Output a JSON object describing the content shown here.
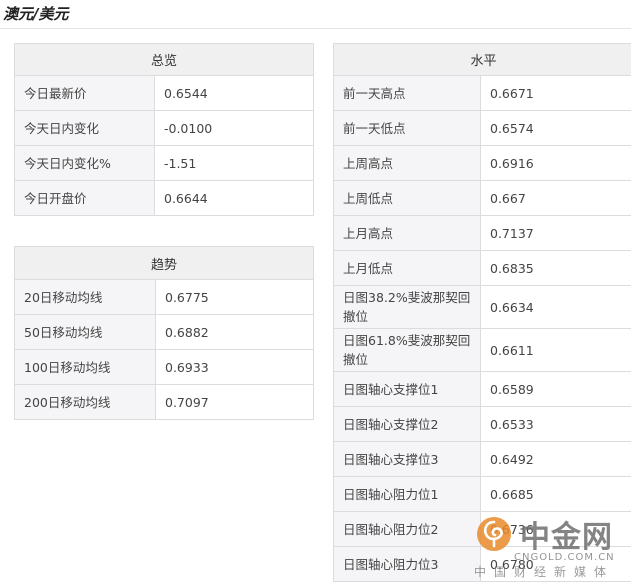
{
  "page": {
    "title": "澳元/美元"
  },
  "overview": {
    "header": "总览",
    "rows": [
      {
        "label": "今日最新价",
        "value": "0.6544"
      },
      {
        "label": "今天日内变化",
        "value": "-0.0100"
      },
      {
        "label": "今天日内变化%",
        "value": "-1.51"
      },
      {
        "label": "今日开盘价",
        "value": "0.6644"
      }
    ]
  },
  "trend": {
    "header": "趋势",
    "rows": [
      {
        "label": "20日移动均线",
        "value": "0.6775"
      },
      {
        "label": "50日移动均线",
        "value": "0.6882"
      },
      {
        "label": "100日移动均线",
        "value": "0.6933"
      },
      {
        "label": "200日移动均线",
        "value": "0.7097"
      }
    ]
  },
  "levels": {
    "header": "水平",
    "rows": [
      {
        "label": "前一天高点",
        "value": "0.6671"
      },
      {
        "label": "前一天低点",
        "value": "0.6574"
      },
      {
        "label": "上周高点",
        "value": "0.6916"
      },
      {
        "label": "上周低点",
        "value": "0.667"
      },
      {
        "label": "上月高点",
        "value": "0.7137"
      },
      {
        "label": "上月低点",
        "value": "0.6835"
      },
      {
        "label": "日图38.2%斐波那契回撤位",
        "value": "0.6634"
      },
      {
        "label": "日图61.8%斐波那契回撤位",
        "value": "0.6611"
      },
      {
        "label": "日图轴心支撑位1",
        "value": "0.6589"
      },
      {
        "label": "日图轴心支撑位2",
        "value": "0.6533"
      },
      {
        "label": "日图轴心支撑位3",
        "value": "0.6492"
      },
      {
        "label": "日图轴心阻力位1",
        "value": "0.6685"
      },
      {
        "label": "日图轴心阻力位2",
        "value": "0.6736"
      },
      {
        "label": "日图轴心阻力位3",
        "value": "0.6780"
      }
    ]
  },
  "watermark": {
    "brand": "中金网",
    "url": "CNGOLD.COM.CN",
    "slogan": "中国财经新媒体",
    "logo_color": "#e8892a"
  }
}
